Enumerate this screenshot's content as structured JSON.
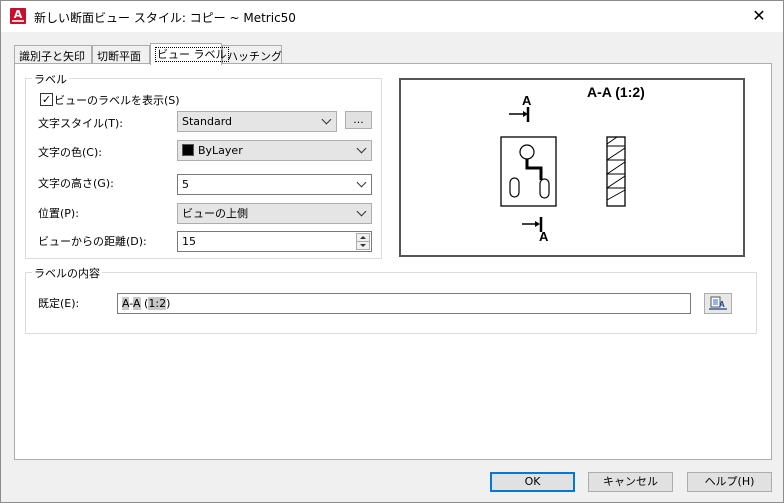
{
  "window": {
    "title": "新しい断面ビュー スタイル: コピー ~ Metric50"
  },
  "tabs": [
    {
      "label": "識別子と矢印",
      "active": false
    },
    {
      "label": "切断平面",
      "active": false
    },
    {
      "label": "ビュー ラベル",
      "active": true
    },
    {
      "label": "ハッチング",
      "active": false
    }
  ],
  "label_group": {
    "title": "ラベル",
    "show_label": {
      "label": "ビューのラベルを表示(S)",
      "checked": true
    },
    "text_style": {
      "label": "文字スタイル(T):",
      "value": "Standard",
      "browse_label": "..."
    },
    "text_color": {
      "label": "文字の色(C):",
      "value": "ByLayer",
      "swatch": "#000000"
    },
    "text_height": {
      "label": "文字の高さ(G):",
      "value": "5"
    },
    "location": {
      "label": "位置(P):",
      "value": "ビューの上側"
    },
    "distance": {
      "label": "ビューからの距離(D):",
      "value": "15"
    }
  },
  "preview": {
    "label_text": "A-A (1:2)",
    "top_marker": "A",
    "bottom_marker": "A"
  },
  "contents_group": {
    "title": "ラベルの内容",
    "default_label": "既定(E):",
    "default_parts": [
      "A",
      "-",
      "A",
      " (",
      "1:2",
      ")"
    ]
  },
  "buttons": {
    "ok": "OK",
    "cancel": "キャンセル",
    "help": "ヘルプ(H)"
  }
}
